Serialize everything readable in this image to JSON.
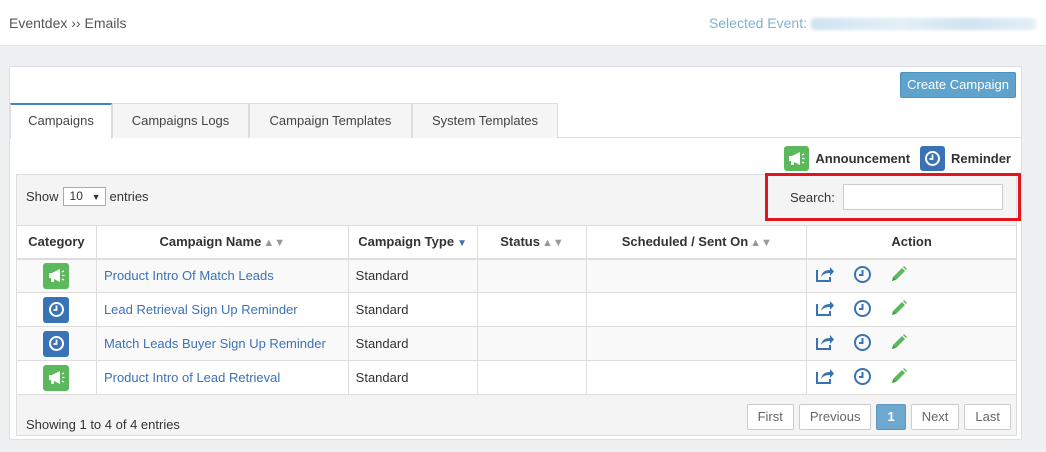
{
  "header": {
    "breadcrumb": "Eventdex ›› Emails",
    "selected_event_label": "Selected Event:"
  },
  "toolbar": {
    "create_label": "Create Campaign"
  },
  "tabs": [
    {
      "label": "Campaigns",
      "active": true
    },
    {
      "label": "Campaigns Logs"
    },
    {
      "label": "Campaign Templates"
    },
    {
      "label": "System Templates"
    }
  ],
  "legend": {
    "announcement": "Announcement",
    "reminder": "Reminder"
  },
  "controls": {
    "show": "Show",
    "entries": "entries",
    "page_size": "10",
    "search_label": "Search:",
    "search_value": ""
  },
  "table": {
    "headers": [
      "Category",
      "Campaign Name",
      "Campaign Type",
      "Status",
      "Scheduled / Sent On",
      "Action"
    ],
    "rows": [
      {
        "category": "announcement",
        "name": "Product Intro Of Match Leads",
        "type": "Standard",
        "status": "",
        "scheduled": ""
      },
      {
        "category": "reminder",
        "name": "Lead Retrieval Sign Up Reminder",
        "type": "Standard",
        "status": "",
        "scheduled": ""
      },
      {
        "category": "reminder",
        "name": "Match Leads Buyer Sign Up Reminder",
        "type": "Standard",
        "status": "",
        "scheduled": ""
      },
      {
        "category": "announcement",
        "name": "Product Intro of Lead Retrieval",
        "type": "Standard",
        "status": "",
        "scheduled": ""
      }
    ]
  },
  "footer": {
    "info": "Showing 1 to 4 of 4 entries",
    "pager": {
      "first": "First",
      "previous": "Previous",
      "current": "1",
      "next": "Next",
      "last": "Last"
    }
  },
  "colors": {
    "accent": "#5fa3cc",
    "announcement": "#5cb85c",
    "reminder": "#3a73b5",
    "highlight": "#e3141d"
  },
  "icons": {
    "announcement": "megaphone-icon",
    "reminder": "clock-icon",
    "action_share": "share-icon",
    "action_schedule": "clock-icon",
    "action_edit": "pencil-icon"
  }
}
